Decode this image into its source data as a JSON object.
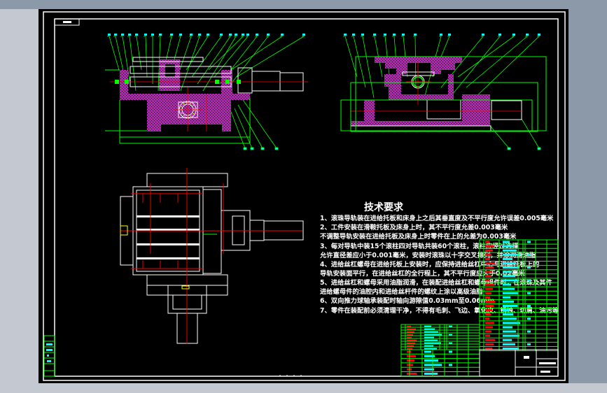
{
  "drawing": {
    "technical_requirements": {
      "title": "技术要求",
      "lines": [
        "1、滚珠导轨装在进给托板和床身上之后其垂直度及不平行度允许误差0.005毫米",
        "2、工件安装在滑鞍托板及床身上时，其不平行度允差0.003毫米",
        "   不调整导轨安装在进给托板及床身上时零件在上的允差为0.003毫米",
        "3、每对导轨中装15个滚柱四对导轨共装60个滚柱，滚柱应经过选择",
        "   允许直径差应小于0.001毫米，安装时滚珠以十字交叉排列，并涂润滑油脂",
        "4、进给丝杠螺母在进给托板上安装时，应保持进给丝杠中心与进给托板上的",
        "   导轨安装面平行，在进给丝杠的全行程上，其不平行度应大于0.02毫米",
        "5、进给丝杠和螺母采用油脂润滑，在装配进给丝杠和螺母组件时，在滚珠及其件",
        "   进给螺母件的油腔内和进给丝杆件的螺纹上涂以高级油脂",
        "6、双向推力球轴承装配时轴向游隙值0.03mm至0.06mm",
        "7、零件在装配前必须清理干净，不得有毛刺、飞边、氧化皮、锈蚀、切屑、油污等"
      ]
    },
    "colors": {
      "background": "#000000",
      "outline": "#ffffff",
      "section_hatch": "#e000e0",
      "centerline": "#ff0000",
      "leader": "#00ff00",
      "balloon": "#00ffff",
      "thread": "#ffff00"
    },
    "views": [
      "front-section-view",
      "side-section-view",
      "top-plan-view"
    ]
  }
}
